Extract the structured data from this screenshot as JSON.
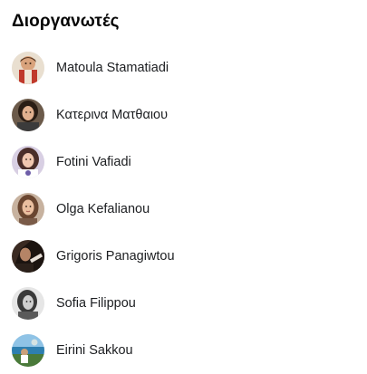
{
  "section": {
    "title": "Διοργανωτές"
  },
  "organizers": [
    {
      "name": "Matoula Stamatiadi",
      "avatar_icon": "person-photo-icon"
    },
    {
      "name": "Κατερινα Ματθαιου",
      "avatar_icon": "person-photo-icon"
    },
    {
      "name": "Fotini Vafiadi",
      "avatar_icon": "person-photo-icon"
    },
    {
      "name": "Olga Kefalianou",
      "avatar_icon": "person-photo-icon"
    },
    {
      "name": "Grigoris Panagiwtou",
      "avatar_icon": "person-photo-icon"
    },
    {
      "name": "Sofia Filippou",
      "avatar_icon": "person-photo-icon"
    },
    {
      "name": "Eirini Sakkou",
      "avatar_icon": "person-photo-icon"
    }
  ]
}
